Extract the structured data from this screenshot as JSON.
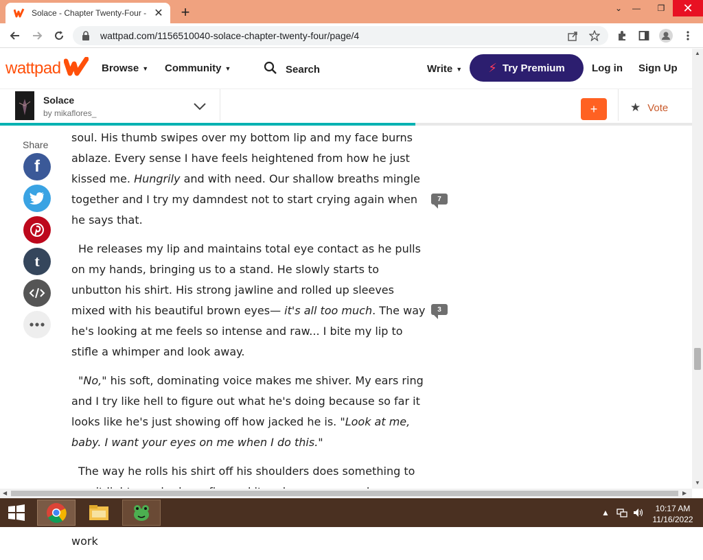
{
  "browser": {
    "tab_title": "Solace - Chapter Twenty-Four - P",
    "url": "wattpad.com/1156510040-solace-chapter-twenty-four/page/4"
  },
  "header": {
    "brand": "wattpad",
    "browse": "Browse",
    "community": "Community",
    "search": "Search",
    "write": "Write",
    "premium": "Try Premium",
    "login": "Log in",
    "signup": "Sign Up",
    "brand_color": "#ff500a"
  },
  "story": {
    "title": "Solace",
    "author": "by mikaflores_",
    "add_label": "+",
    "vote_label": "Vote",
    "reading_progress": 0.6
  },
  "share": {
    "label": "Share",
    "buttons": [
      "facebook-icon",
      "twitter-icon",
      "pinterest-icon",
      "tumblr-icon",
      "embed-icon",
      "more-icon"
    ]
  },
  "paragraphs": {
    "p1a": "soul. His thumb swipes over my bottom lip and my face burns ablaze. Every sense I have feels heightened from how he just kissed me. ",
    "p1b": "Hungrily",
    "p1c": " and with need. Our shallow breaths mingle together and I try my damndest not to start crying again when he says that.",
    "p2a": "He releases my lip and maintains total eye contact as he pulls on my hands, bringing us to a stand. He slowly starts to unbutton his shirt. His strong jawline and rolled up sleeves mixed with his beautiful brown eyes— ",
    "p2b": "it's all too much",
    "p2c": ". The way he's looking at me feels so intense and raw... I bite my lip to stifle a whimper and look away.",
    "p3a": "\"No,\"",
    "p3b": " his soft, dominating voice makes me shiver. My ears ring and I try like hell to figure out what he's doing because so far it looks like he's just showing off how jacked he is. ",
    "p3c": "\"Look at me, baby. I want your eyes on me when I do this.\"",
    "p4": "The way he rolls his shirt off his shoulders does something to me, it lights my body on fire and it makes my core pulse.",
    "p5": "His bare chest is on display, accompanied by the skillful ink work"
  },
  "comments": {
    "c1": "7",
    "c2": "3"
  },
  "taskbar": {
    "time": "10:17 AM",
    "date": "11/16/2022"
  }
}
